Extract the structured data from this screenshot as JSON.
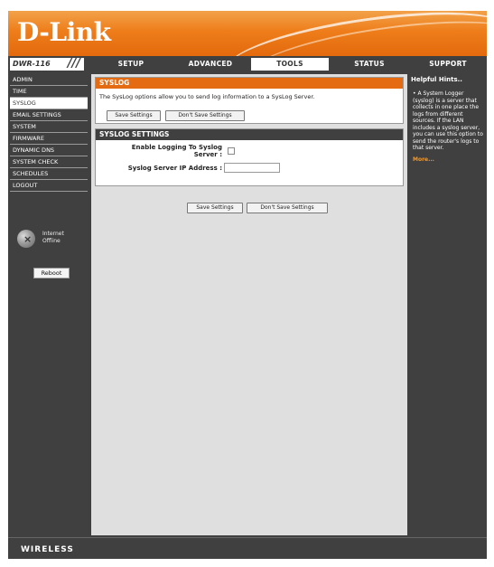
{
  "brand": {
    "logo": "D-Link",
    "model": "DWR-116",
    "model_slashes": "///"
  },
  "tabs": [
    {
      "label": "SETUP",
      "active": false
    },
    {
      "label": "ADVANCED",
      "active": false
    },
    {
      "label": "TOOLS",
      "active": true
    },
    {
      "label": "STATUS",
      "active": false
    },
    {
      "label": "SUPPORT",
      "active": false
    }
  ],
  "sidebar": {
    "items": [
      {
        "label": "ADMIN",
        "active": false
      },
      {
        "label": "TIME",
        "active": false
      },
      {
        "label": "SYSLOG",
        "active": true
      },
      {
        "label": "EMAIL SETTINGS",
        "active": false
      },
      {
        "label": "SYSTEM",
        "active": false
      },
      {
        "label": "FIRMWARE",
        "active": false
      },
      {
        "label": "DYNAMIC DNS",
        "active": false
      },
      {
        "label": "SYSTEM CHECK",
        "active": false
      },
      {
        "label": "SCHEDULES",
        "active": false
      },
      {
        "label": "LOGOUT",
        "active": false
      }
    ],
    "internet_line1": "Internet",
    "internet_line2": "Offline",
    "reboot_label": "Reboot"
  },
  "main": {
    "syslog_title": "SYSLOG",
    "syslog_desc": "The SysLog options allow you to send log information to a SysLog Server.",
    "save_label": "Save Settings",
    "dont_save_label": "Don't Save Settings",
    "settings_title": "SYSLOG SETTINGS",
    "enable_label_line1": "Enable Logging To Syslog",
    "enable_label_line2": "Server :",
    "enable_checked": false,
    "ip_label": "Syslog Server IP Address :",
    "ip_value": ""
  },
  "hints": {
    "title": "Helpful Hints..",
    "body": "• A System Logger (syslog) is a server that collects in one place the logs from different sources. If the LAN includes a syslog server, you can use this option to send the router's logs to that server.",
    "more": "More..."
  },
  "footer": {
    "text": "WIRELESS"
  },
  "colors": {
    "accent": "#e46b12",
    "dark": "#404040",
    "panel": "#dfdfdf"
  }
}
